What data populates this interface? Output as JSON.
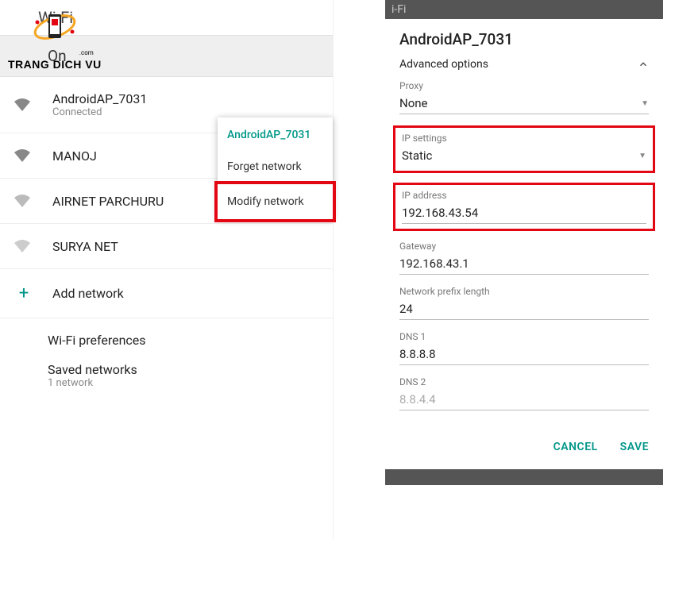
{
  "logo": {
    "text": "TRANG DICH VU",
    "com": ".com"
  },
  "left": {
    "title": "Wi-Fi",
    "toggle": "On",
    "networks": [
      {
        "name": "AndroidAP_7031",
        "sub": "Connected"
      },
      {
        "name": "MANOJ"
      },
      {
        "name": "AIRNET PARCHURU"
      },
      {
        "name": "SURYA NET"
      }
    ],
    "add": "Add network",
    "prefs": "Wi-Fi preferences",
    "saved": {
      "title": "Saved networks",
      "sub": "1 network"
    },
    "ctx": {
      "title": "AndroidAP_7031",
      "forget": "Forget network",
      "modify": "Modify network"
    }
  },
  "right": {
    "topbar": "i-Fi",
    "title": "AndroidAP_7031",
    "advanced": "Advanced options",
    "proxy": {
      "label": "Proxy",
      "value": "None"
    },
    "ip_settings": {
      "label": "IP settings",
      "value": "Static"
    },
    "ip_address": {
      "label": "IP address",
      "value": "192.168.43.54"
    },
    "gateway": {
      "label": "Gateway",
      "value": "192.168.43.1"
    },
    "prefix": {
      "label": "Network prefix length",
      "value": "24"
    },
    "dns1": {
      "label": "DNS 1",
      "value": "8.8.8.8"
    },
    "dns2": {
      "label": "DNS 2",
      "value": "8.8.4.4"
    },
    "cancel": "CANCEL",
    "save": "SAVE"
  }
}
